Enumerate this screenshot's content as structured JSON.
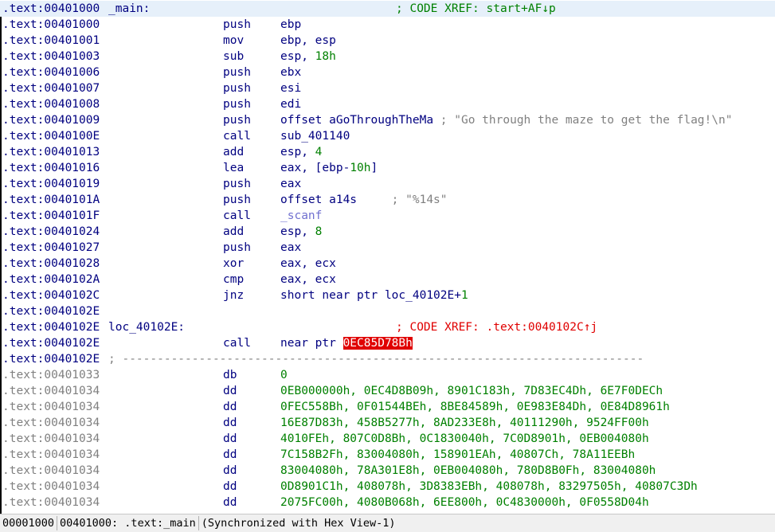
{
  "rows": [
    {
      "addr": ".text:00401000",
      "label": "_main:",
      "xref": "; CODE XREF: start+AF↓p",
      "xref_color": "green",
      "first": true
    },
    {
      "addr": ".text:00401000",
      "mnem": "push",
      "ops": "ebp"
    },
    {
      "addr": ".text:00401001",
      "mnem": "mov",
      "ops": "ebp, esp"
    },
    {
      "addr": ".text:00401003",
      "mnem": "sub",
      "ops": "esp, ",
      "num": "18h"
    },
    {
      "addr": ".text:00401006",
      "mnem": "push",
      "ops": "ebx"
    },
    {
      "addr": ".text:00401007",
      "mnem": "push",
      "ops": "esi"
    },
    {
      "addr": ".text:00401008",
      "mnem": "push",
      "ops": "edi"
    },
    {
      "addr": ".text:00401009",
      "mnem": "push",
      "ops": "offset aGoThroughTheMa",
      "comment": " ; \"Go through the maze to get the flag!\\n\""
    },
    {
      "addr": ".text:0040100E",
      "mnem": "call",
      "ops": "sub_401140"
    },
    {
      "addr": ".text:00401013",
      "mnem": "add",
      "ops": "esp, ",
      "num": "4"
    },
    {
      "addr": ".text:00401016",
      "mnem": "lea",
      "ops": "eax, [ebp-",
      "num": "10h",
      "ops_tail": "]"
    },
    {
      "addr": ".text:00401019",
      "mnem": "push",
      "ops": "eax"
    },
    {
      "addr": ".text:0040101A",
      "mnem": "push",
      "ops": "offset a14s",
      "comment": "     ; \"%14s\""
    },
    {
      "addr": ".text:0040101F",
      "mnem": "call",
      "import": "_scanf"
    },
    {
      "addr": ".text:00401024",
      "mnem": "add",
      "ops": "esp, ",
      "num": "8"
    },
    {
      "addr": ".text:00401027",
      "mnem": "push",
      "ops": "eax"
    },
    {
      "addr": ".text:00401028",
      "mnem": "xor",
      "ops": "eax, ecx"
    },
    {
      "addr": ".text:0040102A",
      "mnem": "cmp",
      "ops": "eax, ecx"
    },
    {
      "addr": ".text:0040102C",
      "mnem": "jnz",
      "ops": "short near ptr loc_40102E+",
      "num": "1"
    },
    {
      "addr": ".text:0040102E"
    },
    {
      "addr": ".text:0040102E",
      "label": "loc_40102E:",
      "xref": "; CODE XREF: .text:0040102C↑j",
      "xref_color": "red"
    },
    {
      "addr": ".text:0040102E",
      "mnem": "call",
      "ops": "near ptr ",
      "danger": "0EC85D78Bh"
    },
    {
      "addr": ".text:0040102E",
      "sep": "; ---------------------------------------------------------------------------"
    },
    {
      "addr": ".text:00401033",
      "dim": true,
      "mnem": "db",
      "num_only": "0"
    },
    {
      "addr": ".text:00401034",
      "dim": true,
      "mnem": "dd",
      "num_only": "0EB000000h, 0EC4D8B09h, 8901C183h, 7D83EC4Dh, 6E7F0DECh"
    },
    {
      "addr": ".text:00401034",
      "dim": true,
      "mnem": "dd",
      "num_only": "0FEC558Bh, 0F01544BEh, 8BE84589h, 0E983E84Dh, 0E84D8961h"
    },
    {
      "addr": ".text:00401034",
      "dim": true,
      "mnem": "dd",
      "num_only": "16E87D83h, 458B5277h, 8AD233E8h, 40111290h, 9524FF00h"
    },
    {
      "addr": ".text:00401034",
      "dim": true,
      "mnem": "dd",
      "num_only": "4010FEh, 807C0D8Bh, 0C1830040h, 7C0D8901h, 0EB004080h"
    },
    {
      "addr": ".text:00401034",
      "dim": true,
      "mnem": "dd",
      "num_only": "7C158B2Fh, 83004080h, 158901EAh, 40807Ch, 78A11EEBh"
    },
    {
      "addr": ".text:00401034",
      "dim": true,
      "mnem": "dd",
      "num_only": "83004080h, 78A301E8h, 0EB004080h, 780D8B0Fh, 83004080h"
    },
    {
      "addr": ".text:00401034",
      "dim": true,
      "mnem": "dd",
      "num_only": "0D8901C1h, 408078h, 3D8383EBh, 408078h, 83297505h, 40807C3Dh"
    },
    {
      "addr": ".text:00401034",
      "dim": true,
      "mnem": "dd",
      "num_only": "2075FC00h, 4080B068h, 6EE800h, 0C4830000h, 0F0558D04h"
    }
  ],
  "statusbar": {
    "offset": "00001000",
    "address": "00401000: .text:_main",
    "sync": "(Synchronized with Hex View-1)"
  }
}
